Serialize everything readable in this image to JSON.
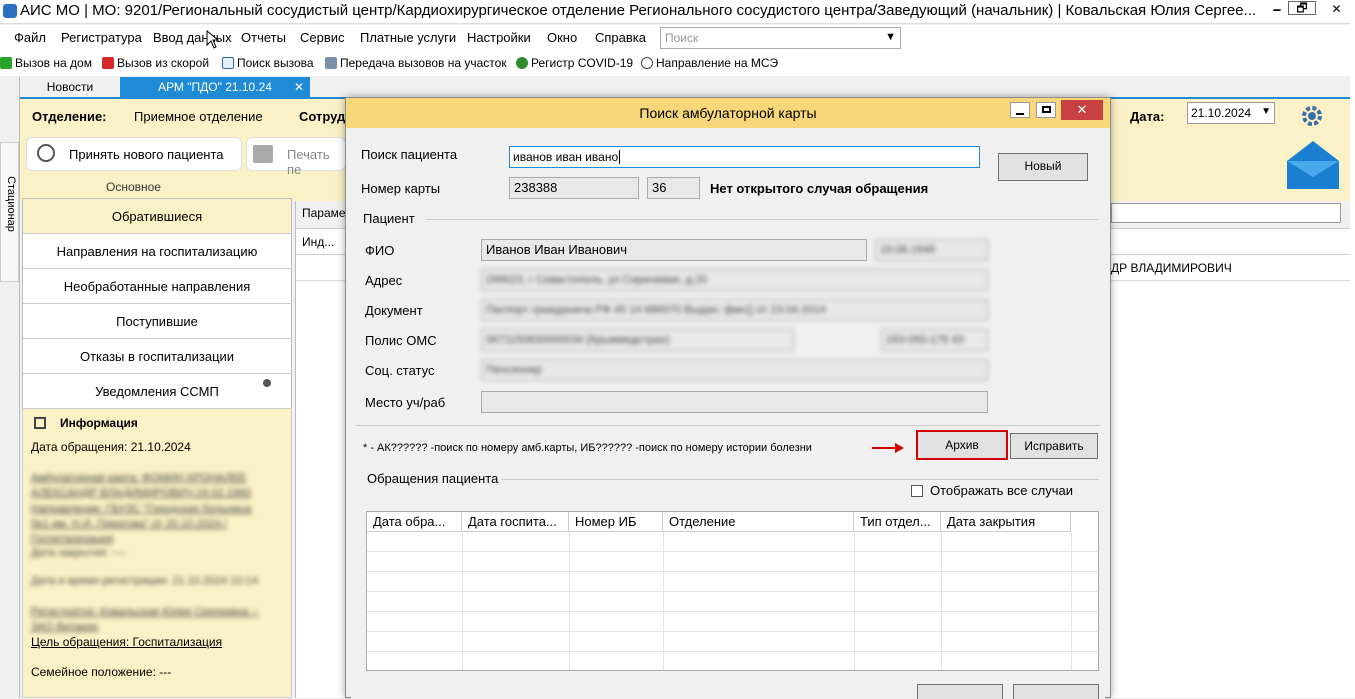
{
  "window": {
    "title": "АИС МО | МО: 9201/Региональный сосудистый центр/Кардиохирургическое отделение Регионального сосудистого центра/Заведующий (начальник) | Ковальская Юлия Сергее...",
    "min": "🗕",
    "max": "🗗",
    "close": "✕"
  },
  "menu": {
    "items": [
      "Файл",
      "Регистратура",
      "Ввод данных",
      "Отчеты",
      "Сервис",
      "Платные услуги",
      "Настройки",
      "Окно",
      "Справка"
    ],
    "search_placeholder": "Поиск"
  },
  "toolbar": {
    "items": [
      "Вызов на дом",
      "Вызов из скорой",
      "Поиск вызова",
      "Передача вызовов на участок",
      "Регистр COVID-19",
      "Направление на МСЭ"
    ]
  },
  "tabs": {
    "news": "Новости",
    "arm": "АРМ \"ПДО\" 21.10.24",
    "close": "✕"
  },
  "side_tab": "Стационар",
  "arm": {
    "dept_label": "Отделение:",
    "dept_value": "Приемное отделение",
    "staff_label": "Сотруд",
    "date_label": "Дата:",
    "date_value": "21.10.2024",
    "new_patient": "Принять нового пациента",
    "print": "Печать пе",
    "group_label": "Основное",
    "params_label": "Параме",
    "index_label": "Инд...",
    "doctor_fragment": "ДР ВЛАДИМИРОВИЧ"
  },
  "left_nav": {
    "items": [
      "Обратившиеся",
      "Направления на госпитализацию",
      "Необработанные направления",
      "Поступившие",
      "Отказы в госпитализации",
      "Уведомления ССМП"
    ]
  },
  "info_panel": {
    "title": "Информация",
    "date": "Дата обращения: 21.10.2024",
    "purpose": "Цель обращения: Госпитализация",
    "family": "Семейное положение: ---",
    "blurred_1": "Амбулаторная карта: ФОМИН КРОНАЛЕЕ АЛЕКСАНДР ВЛАДИМИРОВИЧ 24.02.1960",
    "blurred_2": "Направление: ГБУЗС \"Городская больница №1 им. Н.И. Пирогова\" от 20.10.2024 / Госпитализация",
    "blurred_3": "Дата закрытия: ----",
    "blurred_4": "Дата и время регистрации: 21.10.2024 10:14",
    "blurred_5": "Регистратор: Ковальская Юлия Сергеевна -- ЗАО Витакор"
  },
  "dialog": {
    "title": "Поиск амбулаторной карты",
    "search_label": "Поиск пациента",
    "search_value": "иванов иван ивано",
    "card_label": "Номер карты",
    "card_number": "238388",
    "card_suffix": "36",
    "status": "Нет открытого случая обращения",
    "new_button": "Новый",
    "patient_section": "Пациент",
    "fio_label": "ФИО",
    "fio_value": "Иванов Иван Иванович",
    "birth_value": "19.08.1948",
    "address_label": "Адрес",
    "address_value": "299023, г Севастополь, ул Сиреневая, д.20",
    "doc_label": "Документ",
    "doc_value": "Паспорт гражданина РФ 45 14 686970 Выдан: фмс() от 23.04.2014",
    "oms_label": "Полис ОМС",
    "oms_value": "0671150830000034 (Крыммедстрах)",
    "snils_value": "183-050-178 43",
    "social_label": "Соц. статус",
    "social_value": "Пенсионер",
    "work_label": "Место уч/раб",
    "work_value": "",
    "hint": "* - АК?????? -поиск по номеру амб.карты, ИБ?????? -поиск по номеру истории болезни",
    "archive_button": "Архив",
    "edit_button": "Исправить",
    "visits_section": "Обращения пациента",
    "show_all_label": "Отображать все случаи",
    "columns": [
      "Дата обра...",
      "Дата госпита...",
      "Номер ИБ",
      "Отделение",
      "Тип отдел...",
      "Дата закрытия"
    ]
  },
  "colors": {
    "accent": "#1f8bd6",
    "yellow_panel": "#fbf1c6",
    "dialog_title": "#f7d77a",
    "highlight_red": "#d40000"
  }
}
